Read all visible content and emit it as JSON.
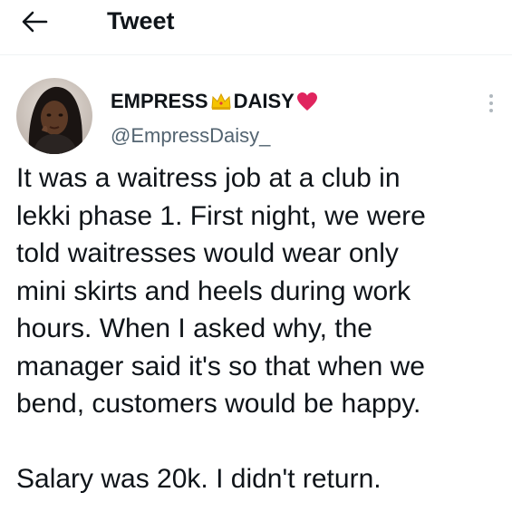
{
  "header": {
    "title": "Tweet",
    "back_icon": "arrow-left-icon"
  },
  "author": {
    "name_part1": "EMPRESS",
    "name_emoji1": "crown-emoji",
    "name_part2": "DAISY",
    "name_emoji2": "red-heart-emoji",
    "handle": "@EmpressDaisy_",
    "avatar": "avatar-photo"
  },
  "tweet": {
    "lines": [
      "It was a waitress job at a club in",
      "lekki phase 1. First night, we were",
      "told waitresses would wear only",
      "mini skirts and heels during work",
      "hours. When I asked why, the",
      "manager said it's so that when we",
      "bend, customers would be happy."
    ],
    "last_line": "Salary was 20k. I didn't return."
  },
  "colors": {
    "text": "#0f1419",
    "secondary": "#536471",
    "divider": "#eff3f4",
    "heart": "#e0245e",
    "crown": "#f5c400"
  }
}
